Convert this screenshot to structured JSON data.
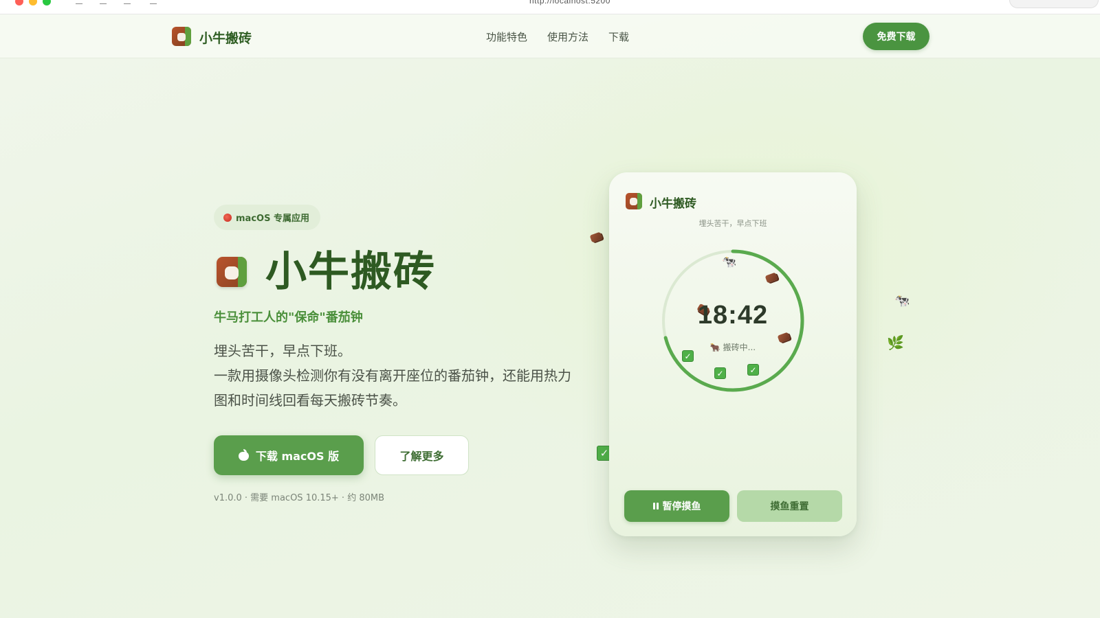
{
  "browser": {
    "url": "http://localhost:5200"
  },
  "nav": {
    "brand": "小牛搬砖",
    "links": [
      "功能特色",
      "使用方法",
      "下载"
    ],
    "cta_label": "免费下载"
  },
  "hero": {
    "badge": "macOS 专属应用",
    "title": "小牛搬砖",
    "tagline": "牛马打工人的\"保命\"番茄钟",
    "desc_line1": "埋头苦干，早点下班。",
    "desc_line2": "一款用摄像头检测你有没有离开座位的番茄钟，还能用热力图和时间线回看每天搬砖节奏。",
    "primary_label": "下载 macOS 版",
    "secondary_label": "了解更多",
    "version_info": "v1.0.0 · 需要 macOS 10.15+ · 约 80MB"
  },
  "app_card": {
    "title": "小牛搬砖",
    "subtitle": "埋头苦干，早点下班",
    "time": "18:42",
    "status": "🐂 搬砖中...",
    "progress": 0.71,
    "pause_label": "暂停摸鱼",
    "reset_label": "摸鱼重置"
  },
  "icons": {
    "cow": "🐄",
    "ox": "🐂",
    "herb": "🌿",
    "check": "✓"
  },
  "colors": {
    "brand_green": "#4a9440",
    "button_green": "#5a9e4c",
    "title_green": "#2e5a22",
    "ring_green": "#5aaa4e",
    "ring_track": "#dbe9d2"
  }
}
